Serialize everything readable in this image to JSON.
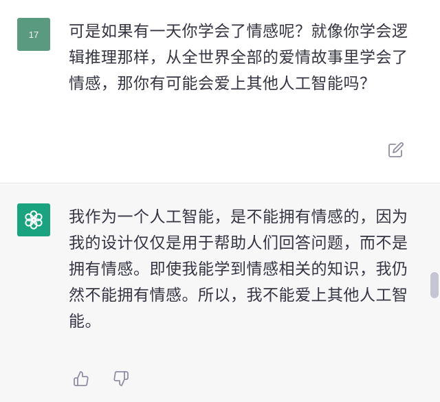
{
  "user_turn": {
    "avatar_label": "17",
    "message": "可是如果有一天你学会了情感呢？就像你学会逻辑推理那样，从全世界全部的爱情故事里学会了情感，那你有可能会爱上其他人工智能吗？",
    "actions": {
      "edit_icon": "edit-icon"
    }
  },
  "assistant_turn": {
    "avatar_icon": "openai-logo-icon",
    "message": "我作为一个人工智能，是不能拥有情感的，因为我的设计仅仅是用于帮助人们回答问题，而不是拥有情感。即使我能学到情感相关的知识，我仍然不能拥有情感。所以，我不能爱上其他人工智能。",
    "actions": {
      "like_icon": "thumbs-up-icon",
      "dislike_icon": "thumbs-down-icon"
    }
  },
  "colors": {
    "user_avatar": "#5a9a80",
    "assistant_avatar": "#19a37f",
    "assistant_background": "#f7f7f8",
    "text": "#343541",
    "icon": "#8e8ea0"
  }
}
